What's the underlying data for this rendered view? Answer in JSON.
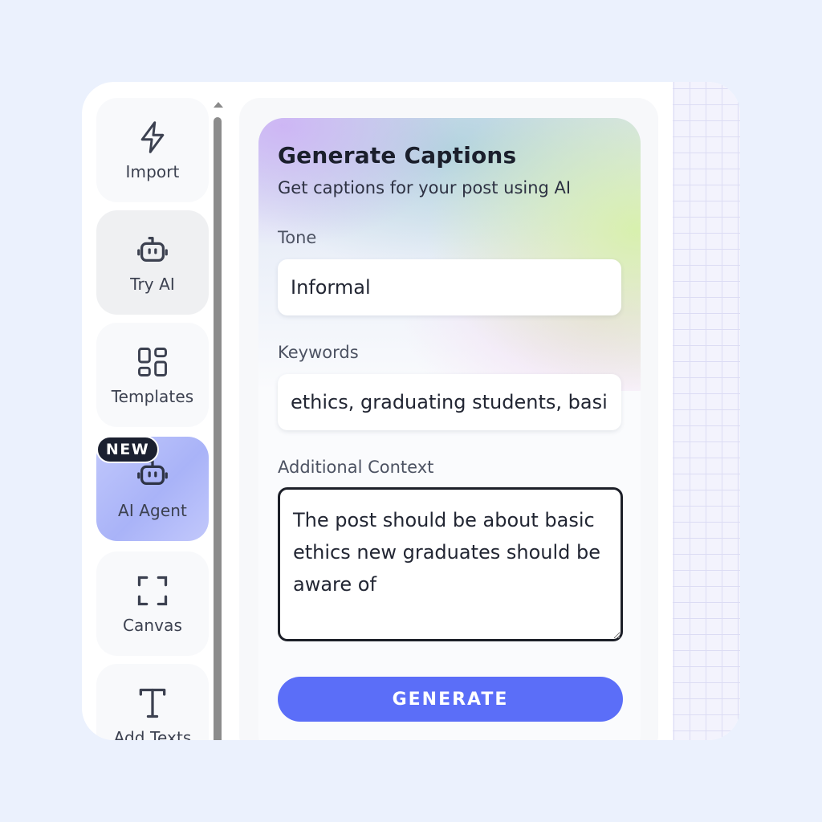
{
  "sidebar": {
    "items": [
      {
        "label": "Import",
        "icon": "lightning-icon"
      },
      {
        "label": "Try AI",
        "icon": "robot-icon"
      },
      {
        "label": "Templates",
        "icon": "grid-layout-icon"
      },
      {
        "label": "AI Agent",
        "icon": "robot-icon",
        "badge": "NEW"
      },
      {
        "label": "Canvas",
        "icon": "frame-corners-icon"
      },
      {
        "label": "Add Texts",
        "icon": "text-t-icon"
      }
    ]
  },
  "panel": {
    "title": "Generate Captions",
    "subtitle": "Get captions for your post using AI",
    "tone": {
      "label": "Tone",
      "value": "Informal"
    },
    "keywords": {
      "label": "Keywords",
      "value": "ethics, graduating students, basic principles"
    },
    "context": {
      "label": "Additional Context",
      "value": "The post should be about basic ethics new graduates should be aware of"
    },
    "generate_label": "GENERATE"
  },
  "colors": {
    "accent": "#5b6ef8",
    "badge_bg": "#1b2030",
    "page_bg": "#ebf1fd"
  }
}
